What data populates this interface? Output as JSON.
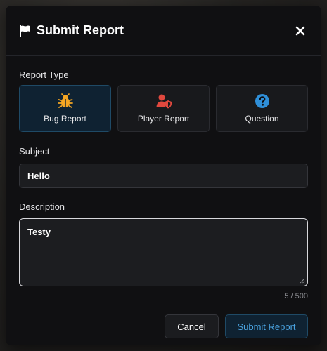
{
  "header": {
    "title": "Submit Report",
    "flag_icon": "flag-icon",
    "close_icon": "close-icon"
  },
  "report_type": {
    "label": "Report Type",
    "options": [
      {
        "label": "Bug Report",
        "icon": "bug-icon",
        "color": "#f5a623",
        "selected": true
      },
      {
        "label": "Player Report",
        "icon": "user-shield-icon",
        "color": "#e0483e",
        "selected": false
      },
      {
        "label": "Question",
        "icon": "question-circle-icon",
        "color": "#2f8fd8",
        "selected": false
      }
    ]
  },
  "subject": {
    "label": "Subject",
    "value": "Hello"
  },
  "description": {
    "label": "Description",
    "value": "Testy",
    "counter": "5 / 500"
  },
  "actions": {
    "cancel_label": "Cancel",
    "submit_label": "Submit Report"
  },
  "colors": {
    "accent": "#4aa3e0",
    "modal_bg": "#101012",
    "selected_bg": "#0f2232"
  }
}
